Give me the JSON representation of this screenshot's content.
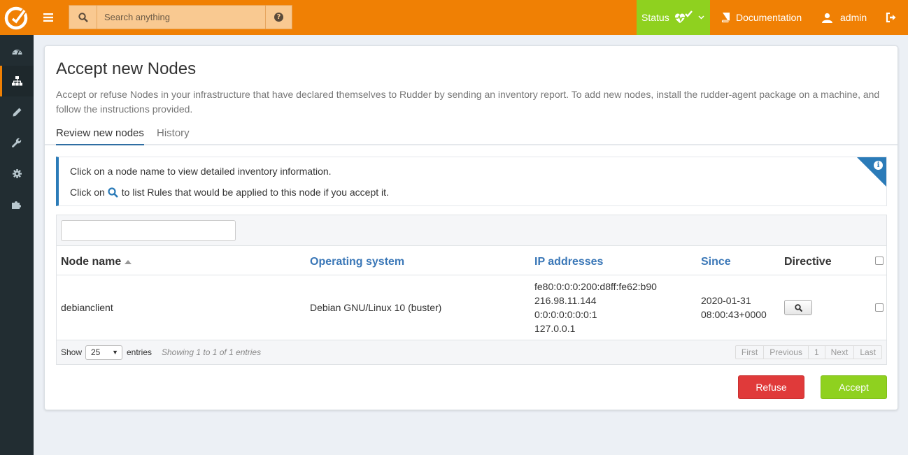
{
  "header": {
    "search_placeholder": "Search anything",
    "status_label": "Status",
    "documentation_label": "Documentation",
    "user_label": "admin"
  },
  "sidebar": {
    "items": [
      {
        "icon": "dashboard-icon"
      },
      {
        "icon": "sitemap-icon",
        "active": true
      },
      {
        "icon": "pencil-icon"
      },
      {
        "icon": "wrench-icon"
      },
      {
        "icon": "gear-icon"
      },
      {
        "icon": "puzzle-icon"
      }
    ]
  },
  "page": {
    "title": "Accept new Nodes",
    "description": "Accept or refuse Nodes in your infrastructure that have declared themselves to Rudder by sending an inventory report. To add new nodes, install the rudder-agent package on a machine, and follow the instructions provided.",
    "tabs": [
      {
        "label": "Review new nodes",
        "active": true
      },
      {
        "label": "History",
        "active": false
      }
    ]
  },
  "info": {
    "line1": "Click on a node name to view detailed inventory information.",
    "line2_prefix": "Click on",
    "line2_suffix": "to list Rules that would be applied to this node if you accept it."
  },
  "table": {
    "columns": [
      "Node name",
      "Operating system",
      "IP addresses",
      "Since",
      "Directive"
    ],
    "rows": [
      {
        "node_name": "debianclient",
        "os": "Debian GNU/Linux 10 (buster)",
        "ips": [
          "fe80:0:0:0:200:d8ff:fe62:b90",
          "216.98.11.144",
          "0:0:0:0:0:0:0:1",
          "127.0.0.1"
        ],
        "since": [
          "2020-01-31",
          "08:00:43+0000"
        ]
      }
    ],
    "footer": {
      "show_label": "Show",
      "page_size": "25",
      "entries_label": "entries",
      "showing": "Showing 1 to 1 of 1 entries",
      "pager": [
        "First",
        "Previous",
        "1",
        "Next",
        "Last"
      ]
    }
  },
  "actions": {
    "refuse_label": "Refuse",
    "accept_label": "Accept"
  },
  "colors": {
    "brand": "#f08004",
    "success": "#8fd11f",
    "danger": "#e03a3a",
    "link": "#3a77b7",
    "sidebar": "#222d32"
  }
}
